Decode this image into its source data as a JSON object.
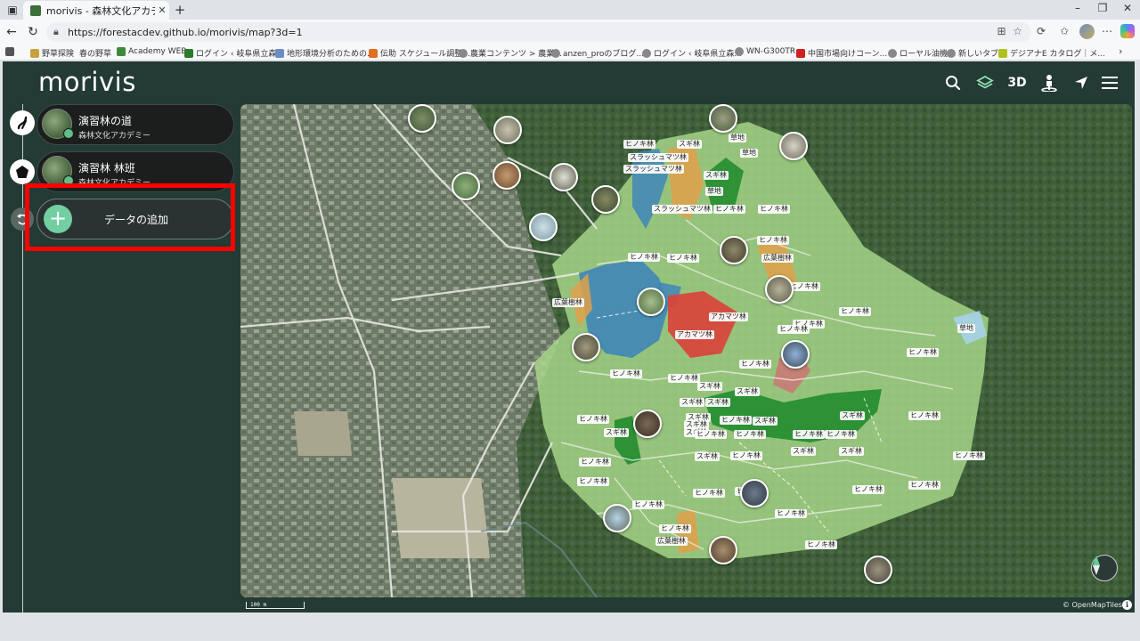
{
  "browser": {
    "tab_title": "morivis - 森林文化アカデミー演習林",
    "url": "https://forestacdev.github.io/morivis/map?3d=1",
    "bookmarks": [
      "野草探険",
      "春の野草",
      "Academy WEB",
      "ログイン ‹ 岐阜県立森...",
      "地形環境分析のための...",
      "伝助 スケジュール調整...",
      "農業コンテンツ > 農業...",
      "anzen_proのブログ...",
      "ログイン ‹ 岐阜県立森...",
      "WN-G300TR",
      "中国市場向けコーン...",
      "ローヤル油機",
      "新しいタブ",
      "デジアナE カタログ｜メ..."
    ]
  },
  "app": {
    "logo": "morivis",
    "header_icons": [
      "search-icon",
      "layers-icon",
      "3d-toggle",
      "person-icon",
      "location-arrow-icon",
      "menu-icon"
    ],
    "header_3d_label": "3D",
    "layers": [
      {
        "title": "演習林の道",
        "subtitle": "森林文化アカデミー",
        "icon": "route-icon"
      },
      {
        "title": "演習林 林班",
        "subtitle": "森林文化アカデミー",
        "icon": "pentagon-icon"
      }
    ],
    "add_data_label": "データの追加",
    "accent_color": "#72cfa2",
    "highlight_color": "#ff0000"
  },
  "map": {
    "stand_labels": [
      {
        "text": "ヒノキ林"
      },
      {
        "text": "スギ林"
      },
      {
        "text": "スラッシュマツ林"
      },
      {
        "text": "スラッシュマツ林"
      },
      {
        "text": "草地"
      },
      {
        "text": "草地"
      },
      {
        "text": "スギ林"
      },
      {
        "text": "草地"
      },
      {
        "text": "スラッシュマツ林"
      },
      {
        "text": "ヒノキ林"
      },
      {
        "text": "ヒノキ林"
      },
      {
        "text": "ヒノキ林"
      },
      {
        "text": "ヒノキ林"
      },
      {
        "text": "広葉樹林"
      },
      {
        "text": "ヒノキ林"
      },
      {
        "text": "ヒノキ林"
      },
      {
        "text": "広葉樹林"
      },
      {
        "text": "ヒノキ林"
      },
      {
        "text": "ヒノキ林"
      },
      {
        "text": "アカマツ林"
      },
      {
        "text": "アカマツ林"
      },
      {
        "text": "ヒノキ林"
      },
      {
        "text": "ヒノキ林"
      },
      {
        "text": "草地"
      },
      {
        "text": "ヒノキ林"
      },
      {
        "text": "ヒノキ林"
      },
      {
        "text": "ヒノキ林"
      },
      {
        "text": "スギ林"
      },
      {
        "text": "スギ林"
      },
      {
        "text": "スギ林"
      },
      {
        "text": "スギ林"
      },
      {
        "text": "スギ林"
      },
      {
        "text": "ヒノキ林"
      },
      {
        "text": "スギ林"
      },
      {
        "text": "ヒノキ林"
      },
      {
        "text": "スギ林"
      },
      {
        "text": "スギ林"
      },
      {
        "text": "ヒノキ林"
      },
      {
        "text": "スギ林"
      },
      {
        "text": "スギ林"
      },
      {
        "text": "ヒノキ林"
      },
      {
        "text": "ヒノキ林"
      },
      {
        "text": "ヒノキ林"
      },
      {
        "text": "スギ林"
      },
      {
        "text": "スギ林"
      },
      {
        "text": "ヒノキ林"
      },
      {
        "text": "スギ林"
      },
      {
        "text": "ヒノキ林"
      },
      {
        "text": "ヒノキ林"
      },
      {
        "text": "ヒノキ林"
      },
      {
        "text": "ヒノキ林"
      },
      {
        "text": "ヒノキ林"
      },
      {
        "text": "ヒノキ林"
      },
      {
        "text": "ヒノキ林"
      },
      {
        "text": "ヒノキ林"
      },
      {
        "text": "広葉樹林"
      },
      {
        "text": "ヒノキ林"
      },
      {
        "text": "ヒノキ林"
      },
      {
        "text": "ヒノキ林"
      },
      {
        "text": "ヒノキ林"
      }
    ],
    "scale_label": "100 m",
    "attribution": "© OpenMapTiles",
    "compass": "compass-icon"
  }
}
